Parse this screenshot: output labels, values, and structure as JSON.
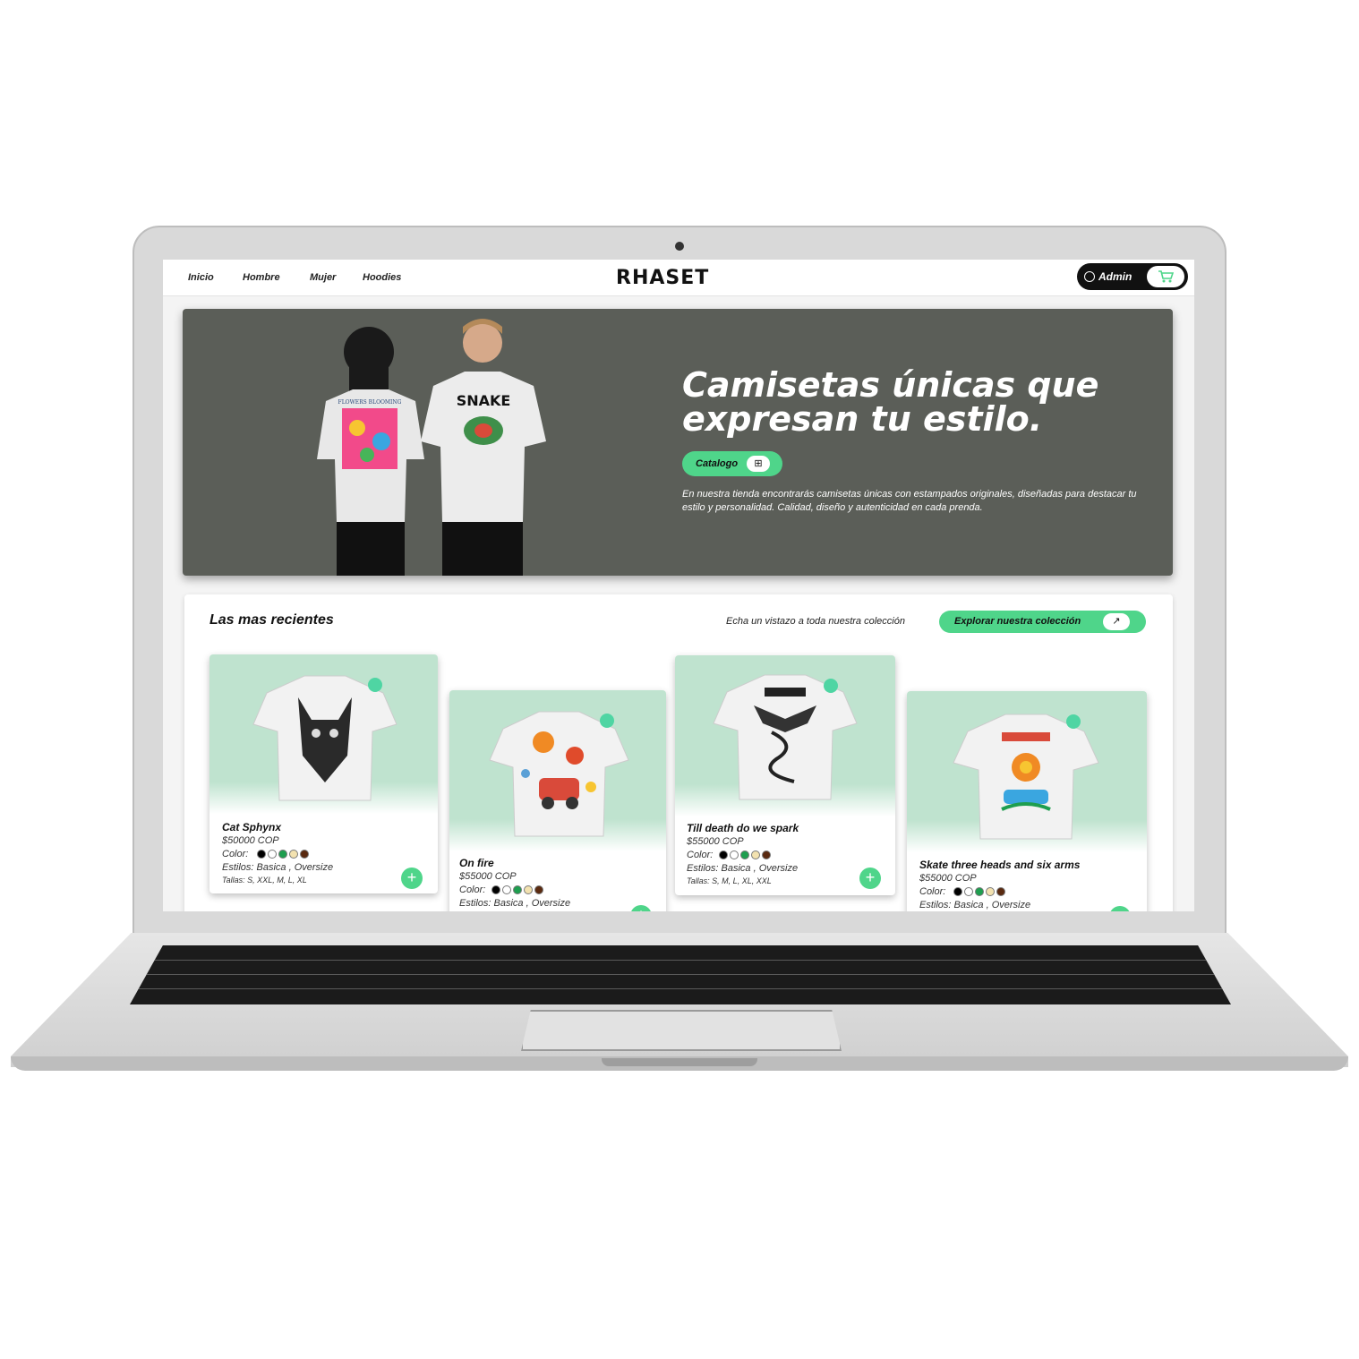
{
  "nav": {
    "links": [
      "Inicio",
      "Hombre",
      "Mujer",
      "Hoodies"
    ],
    "brand": "RHASET",
    "admin_label": "Admin"
  },
  "hero": {
    "title": "Camisetas únicas que expresan tu estilo.",
    "catalog_label": "Catalogo",
    "description": "En nuestra tienda encontrarás camisetas únicas con estampados originales, diseñadas para destacar tu estilo y personalidad. Calidad, diseño y autenticidad en cada prenda.",
    "shirt_prints": [
      "FLOWERS BLOOMING",
      "SNAKE"
    ]
  },
  "recent": {
    "title": "Las mas recientes",
    "subtitle": "Echa un vistazo a toda nuestra colección",
    "explore_label": "Explorar nuestra colección"
  },
  "products": [
    {
      "name": "Cat Sphynx",
      "price": "$50000 COP",
      "color_label": "Color:",
      "styles": "Estilos: Basica , Oversize",
      "sizes": "Tallas: S, XXL, M, L, XL"
    },
    {
      "name": "On fire",
      "price": "$55000 COP",
      "color_label": "Color:",
      "styles": "Estilos: Basica , Oversize",
      "sizes": ""
    },
    {
      "name": "Till death do we spark",
      "price": "$55000 COP",
      "color_label": "Color:",
      "styles": "Estilos: Basica , Oversize",
      "sizes": "Tallas: S, M, L, XL, XXL"
    },
    {
      "name": "Skate three heads and six arms",
      "price": "$55000 COP",
      "color_label": "Color:",
      "styles": "Estilos: Basica , Oversize",
      "sizes": ""
    }
  ],
  "swatch_colors": [
    "#000000",
    "#ffffff",
    "#1e9e4f",
    "#f3e2b0",
    "#5a2a10"
  ],
  "colors": {
    "accent": "#4fd58a",
    "hero_bg": "#5b5e58",
    "card_bg": "#bfe3cf"
  }
}
